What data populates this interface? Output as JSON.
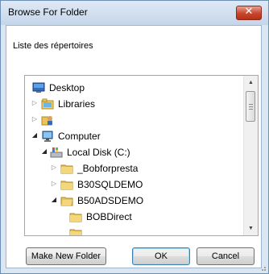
{
  "window": {
    "title": "Browse For Folder",
    "close_label": "✕"
  },
  "header": {
    "text": "Liste des répertoires"
  },
  "tree": {
    "items": [
      {
        "label": "Desktop",
        "icon": "desktop-icon",
        "expander": "none"
      },
      {
        "label": "Libraries",
        "icon": "libraries-icon",
        "expander": "collapsed"
      },
      {
        "label": "",
        "icon": "user-folder-icon",
        "expander": "collapsed"
      },
      {
        "label": "Computer",
        "icon": "computer-icon",
        "expander": "expanded"
      },
      {
        "label": "Local Disk (C:)",
        "icon": "local-disk-icon",
        "expander": "expanded"
      },
      {
        "label": "_Bobforpresta",
        "icon": "folder-icon",
        "expander": "collapsed"
      },
      {
        "label": "B30SQLDEMO",
        "icon": "folder-icon",
        "expander": "collapsed"
      },
      {
        "label": "B50ADSDEMO",
        "icon": "folder-icon",
        "expander": "expanded"
      },
      {
        "label": "BOBDirect",
        "icon": "folder-icon",
        "expander": "none"
      },
      {
        "label": "",
        "icon": "folder-icon",
        "expander": "none"
      }
    ]
  },
  "buttons": {
    "make_new_folder": "Make New Folder",
    "ok": "OK",
    "cancel": "Cancel"
  },
  "colors": {
    "title_bar": "#c5d6ea",
    "close_button": "#c8452d",
    "folder": "#e8c25a"
  }
}
